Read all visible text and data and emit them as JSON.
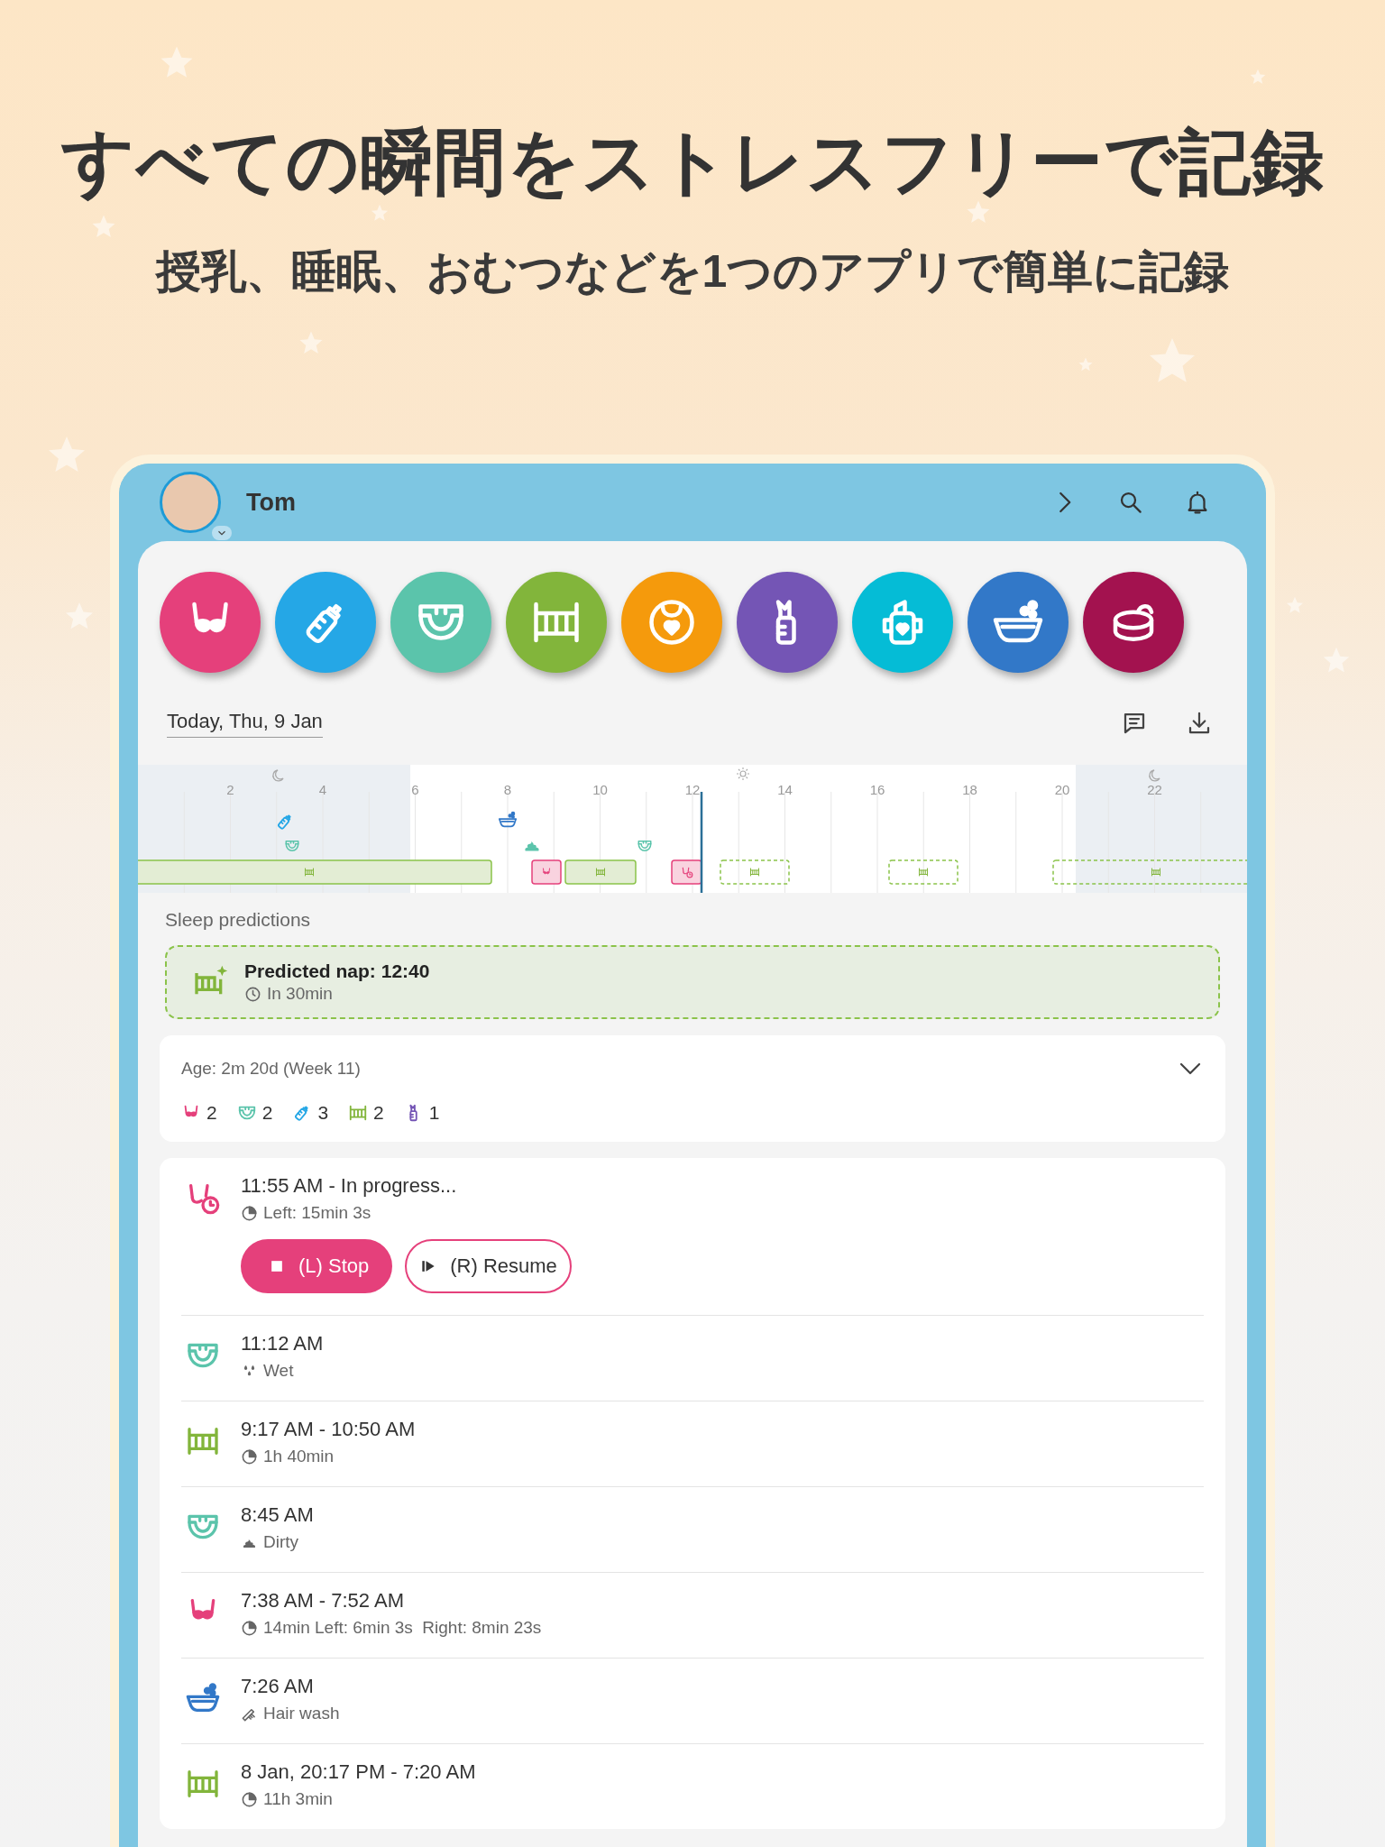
{
  "headline": "すべての瞬間をストレスフリーで記録",
  "subheadline": "授乳、睡眠、おむつなどを1つのアプリで簡単に記録",
  "header": {
    "name": "Tom"
  },
  "quick_actions": [
    {
      "kind": "breastfeed",
      "color": "#e5407b"
    },
    {
      "kind": "bottle",
      "color": "#25a7e6"
    },
    {
      "kind": "diaper",
      "color": "#5bc4ab"
    },
    {
      "kind": "sleep",
      "color": "#82b53b"
    },
    {
      "kind": "bib",
      "color": "#f59a0c"
    },
    {
      "kind": "pump",
      "color": "#7455b5"
    },
    {
      "kind": "cup",
      "color": "#05bcd6"
    },
    {
      "kind": "bath",
      "color": "#3278c8"
    },
    {
      "kind": "potty",
      "color": "#a3124f"
    }
  ],
  "date": "Today, Thu, 9 Jan",
  "timeline": {
    "hour_labels": [
      "2",
      "4",
      "6",
      "8",
      "10",
      "12",
      "14",
      "16",
      "18",
      "20",
      "22"
    ]
  },
  "sleep_predictions": {
    "label": "Sleep predictions",
    "title": "Predicted nap: 12:40",
    "subtitle": "In 30min"
  },
  "summary": {
    "age": "Age: 2m 20d (Week 11)",
    "counts": [
      {
        "kind": "breastfeed",
        "count": "2"
      },
      {
        "kind": "diaper",
        "count": "2"
      },
      {
        "kind": "bottle",
        "count": "3"
      },
      {
        "kind": "sleep",
        "count": "2"
      },
      {
        "kind": "pump",
        "count": "1"
      }
    ]
  },
  "log": [
    {
      "kind": "breastfeed_timer",
      "title": "11:55 AM - In progress...",
      "detail": {
        "kind": "duration",
        "text": "Left: 15min 3s"
      },
      "actions": [
        {
          "kind": "stop",
          "label": "(L) Stop"
        },
        {
          "kind": "resume",
          "label": "(R) Resume"
        }
      ]
    },
    {
      "kind": "diaper",
      "title": "11:12 AM",
      "detail": {
        "kind": "wet",
        "text": "Wet"
      }
    },
    {
      "kind": "sleep",
      "title": "9:17 AM - 10:50 AM",
      "detail": {
        "kind": "duration",
        "text": "1h 40min"
      }
    },
    {
      "kind": "diaper",
      "title": "8:45 AM",
      "detail": {
        "kind": "dirty",
        "text": "Dirty"
      }
    },
    {
      "kind": "breastfeed",
      "title": "7:38 AM - 7:52 AM",
      "detail": {
        "kind": "duration",
        "text": "14min Left: 6min 3s  Right: 8min 23s"
      }
    },
    {
      "kind": "bath",
      "title": "7:26 AM",
      "detail": {
        "kind": "hair",
        "text": "Hair wash"
      }
    },
    {
      "kind": "sleep",
      "title": "8 Jan, 20:17 PM - 7:20 AM",
      "detail": {
        "kind": "duration",
        "text": "11h 3min"
      }
    }
  ]
}
